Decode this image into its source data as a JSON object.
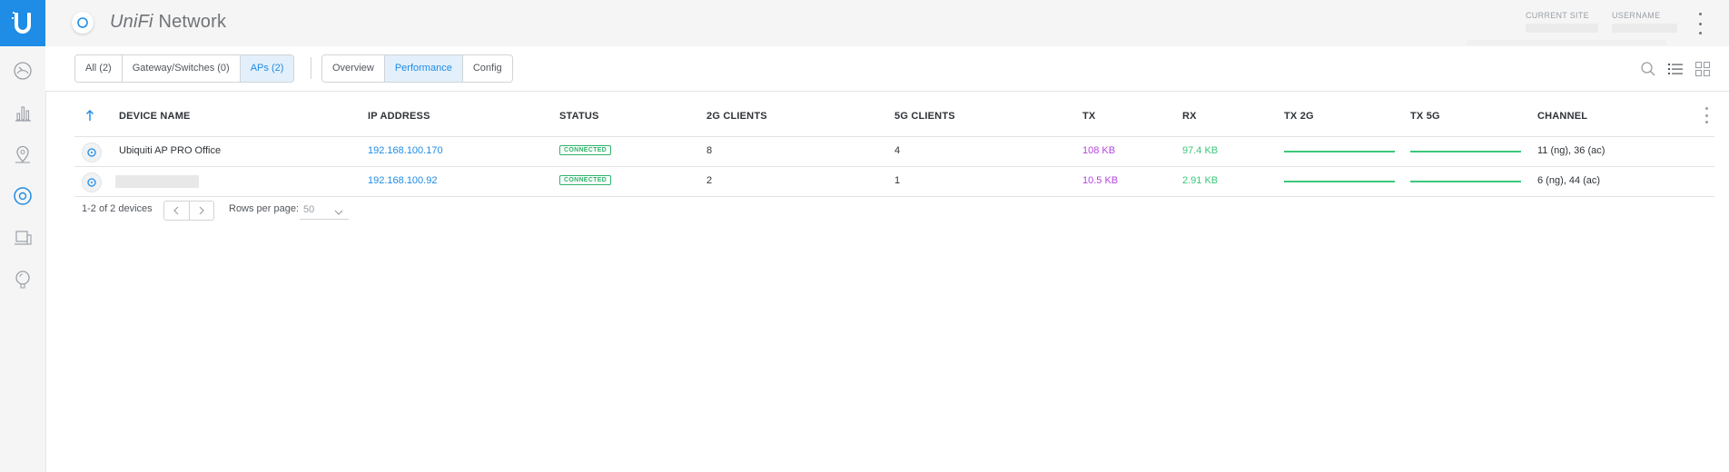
{
  "app": {
    "brand_prefix": "UniFi",
    "brand_suffix": "Network"
  },
  "header": {
    "current_site_label": "CURRENT SITE",
    "username_label": "USERNAME"
  },
  "filters": [
    {
      "label": "All (2)",
      "active": false
    },
    {
      "label": "Gateway/Switches (0)",
      "active": false
    },
    {
      "label": "APs (2)",
      "active": true
    }
  ],
  "views": [
    {
      "label": "Overview",
      "active": false
    },
    {
      "label": "Performance",
      "active": true
    },
    {
      "label": "Config",
      "active": false
    }
  ],
  "table": {
    "columns": [
      "DEVICE NAME",
      "IP ADDRESS",
      "STATUS",
      "2G CLIENTS",
      "5G CLIENTS",
      "TX",
      "RX",
      "TX 2G",
      "TX 5G",
      "CHANNEL"
    ],
    "rows": [
      {
        "name": "Ubiquiti AP PRO Office",
        "ip": "192.168.100.170",
        "status": "CONNECTED",
        "clients_2g": "8",
        "clients_5g": "4",
        "tx": "108 KB",
        "rx": "97.4 KB",
        "channel": "11 (ng), 36 (ac)"
      },
      {
        "name": "",
        "ip": "192.168.100.92",
        "status": "CONNECTED",
        "clients_2g": "2",
        "clients_5g": "1",
        "tx": "10.5 KB",
        "rx": "2.91 KB",
        "channel": "6 (ng), 44 (ac)"
      }
    ]
  },
  "footer": {
    "count": "1-2 of 2 devices",
    "rows_per_page_label": "Rows per page:",
    "rows_per_page": "50"
  },
  "colors": {
    "accent": "#1f8ce6",
    "tx": "#b445e0",
    "rx": "#3cc77a",
    "connected": "#2fb36a"
  }
}
